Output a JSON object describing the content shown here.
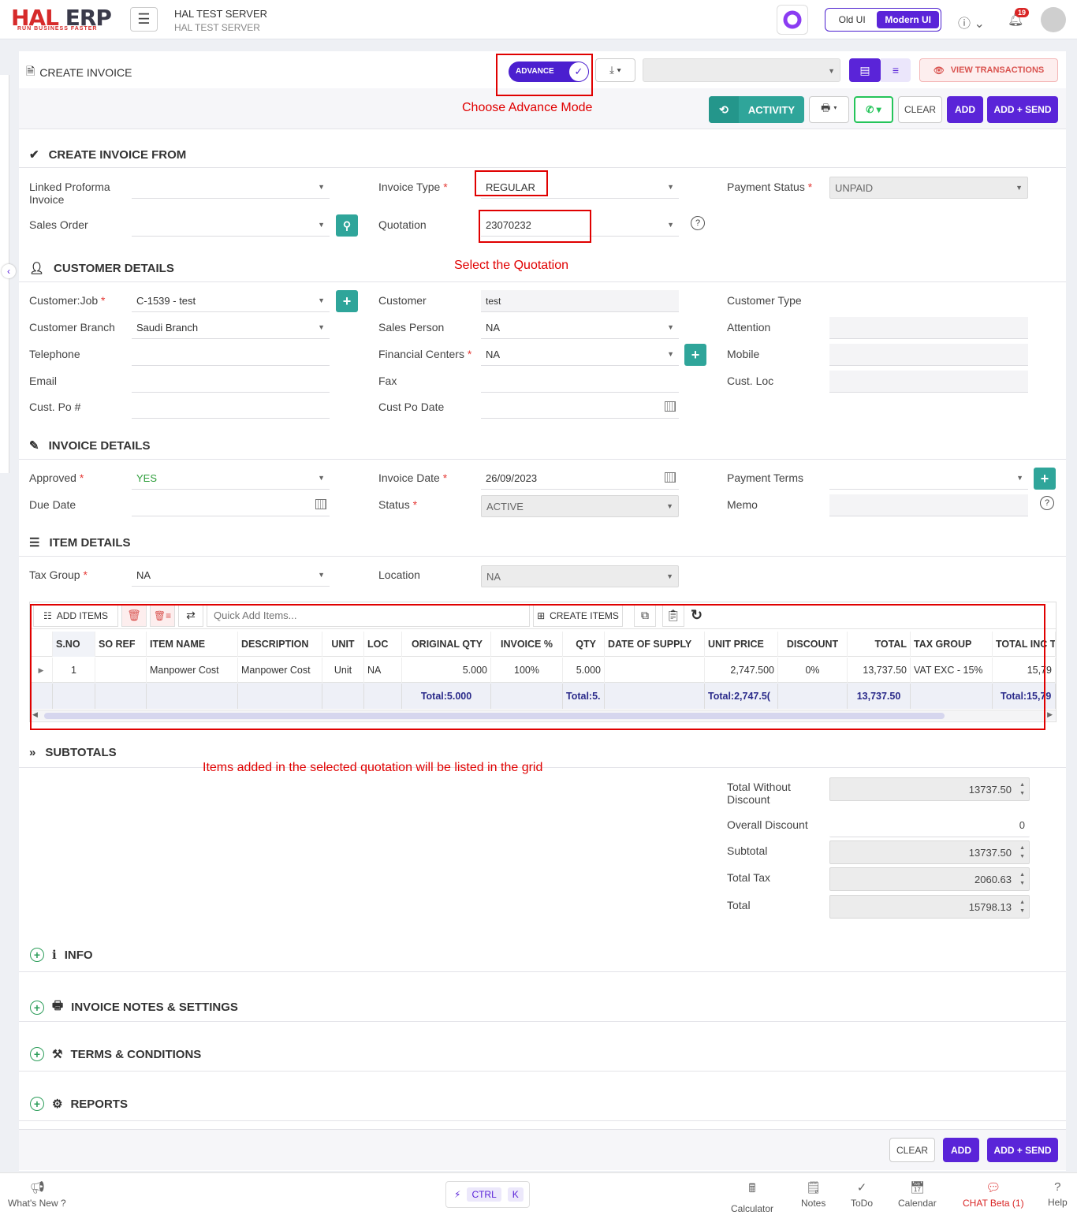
{
  "app": {
    "logo_main": "HAL",
    "logo_accent": "ERP",
    "tagline": "RUN BUSINESS FASTER",
    "server_title": "HAL TEST SERVER",
    "server_sub": "HAL TEST SERVER",
    "old_ui": "Old UI",
    "modern_ui": "Modern UI",
    "notif_count": "19"
  },
  "page": {
    "title": "CREATE INVOICE",
    "advance_label": "ADVANCE",
    "view_transactions": "VIEW TRANSACTIONS",
    "activity": "ACTIVITY",
    "clear": "CLEAR",
    "add": "ADD",
    "add_send": "ADD + SEND"
  },
  "annotations": {
    "advance": "Choose Advance Mode",
    "quotation": "Select the Quotation",
    "grid": "Items added in the selected quotation will be listed in the grid"
  },
  "create_from": {
    "heading": "CREATE INVOICE FROM",
    "linked_proforma_l1": "Linked Proforma",
    "linked_proforma_l2": "Invoice",
    "linked_proforma_value": "",
    "sales_order_label": "Sales Order",
    "sales_order_value": "",
    "invoice_type_label": "Invoice Type",
    "invoice_type_value": "REGULAR",
    "quotation_label": "Quotation",
    "quotation_value": "23070232",
    "payment_status_label": "Payment Status",
    "payment_status_value": "UNPAID"
  },
  "customer": {
    "heading": "CUSTOMER DETAILS",
    "customer_job_label": "Customer:Job",
    "customer_job_value": "C-1539 - test",
    "customer_branch_label": "Customer Branch",
    "customer_branch_value": "Saudi Branch",
    "telephone_label": "Telephone",
    "email_label": "Email",
    "cust_po_label": "Cust. Po #",
    "customer_label": "Customer",
    "customer_value": "test",
    "sales_person_label": "Sales Person",
    "sales_person_value": "NA",
    "financial_centers_label": "Financial Centers",
    "financial_centers_value": "NA",
    "fax_label": "Fax",
    "cust_po_date_label": "Cust Po Date",
    "customer_type_label": "Customer Type",
    "attention_label": "Attention",
    "mobile_label": "Mobile",
    "cust_loc_label": "Cust. Loc"
  },
  "invoice": {
    "heading": "INVOICE DETAILS",
    "approved_label": "Approved",
    "approved_value": "YES",
    "due_date_label": "Due Date",
    "invoice_date_label": "Invoice Date",
    "invoice_date_value": "26/09/2023",
    "status_label": "Status",
    "status_value": "ACTIVE",
    "payment_terms_label": "Payment Terms",
    "memo_label": "Memo"
  },
  "items": {
    "heading": "ITEM DETAILS",
    "tax_group_label": "Tax Group",
    "tax_group_value": "NA",
    "location_label": "Location",
    "location_value": "NA",
    "toolbar": {
      "add_items": "ADD ITEMS",
      "quick_add_placeholder": "Quick Add Items...",
      "create_items": "CREATE ITEMS"
    },
    "columns": [
      "S.NO",
      "SO REF",
      "ITEM NAME",
      "DESCRIPTION",
      "UNIT",
      "LOC",
      "ORIGINAL QTY",
      "INVOICE %",
      "QTY",
      "DATE OF SUPPLY",
      "UNIT PRICE",
      "DISCOUNT",
      "TOTAL",
      "TAX GROUP",
      "TOTAL INC T"
    ],
    "rows": [
      {
        "sno": "1",
        "so_ref": "",
        "item_name": "Manpower Cost",
        "description": "Manpower Cost",
        "unit": "Unit",
        "loc": "NA",
        "original_qty": "5.000",
        "invoice_pct": "100%",
        "qty": "5.000",
        "date_of_supply": "",
        "unit_price": "2,747.500",
        "discount": "0%",
        "total": "13,737.50",
        "tax_group": "VAT EXC - 15%",
        "total_inc": "15,79"
      }
    ],
    "footer": {
      "original_qty": "Total:5.000",
      "qty": "Total:5.",
      "unit_price": "Total:2,747.5(",
      "total": "13,737.50",
      "total_inc": "Total:15,79"
    }
  },
  "subtotals": {
    "heading": "SUBTOTALS",
    "twd_l1": "Total Without",
    "twd_l2": "Discount",
    "twd_value": "13737.50",
    "overall_discount_label": "Overall Discount",
    "overall_discount_value": "0",
    "subtotal_label": "Subtotal",
    "subtotal_value": "13737.50",
    "total_tax_label": "Total Tax",
    "total_tax_value": "2060.63",
    "total_label": "Total",
    "total_value": "15798.13"
  },
  "collapsibles": {
    "info": "INFO",
    "notes": "INVOICE NOTES & SETTINGS",
    "terms": "TERMS & CONDITIONS",
    "reports": "REPORTS"
  },
  "footer": {
    "whats_new": "What's New ?",
    "ctrl": "CTRL",
    "k": "K",
    "calculator": "Calculator",
    "notes": "Notes",
    "todo": "ToDo",
    "calendar": "Calendar",
    "chat": "CHAT Beta (1)",
    "help": "Help"
  },
  "colors": {
    "primary": "#5a24d8",
    "teal": "#2fa59a",
    "red": "#e00000",
    "green": "#25c45a"
  }
}
